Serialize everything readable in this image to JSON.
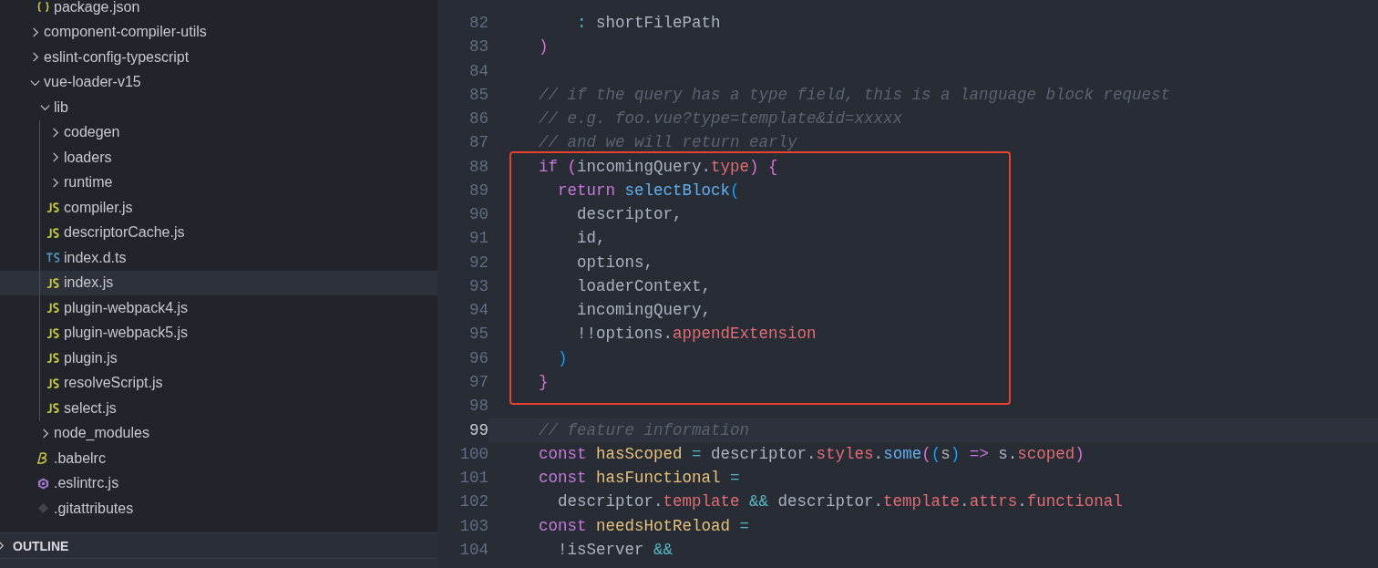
{
  "explorer": {
    "tree": [
      {
        "children": [
          {
            "name": "package.json",
            "kind": "json",
            "selected": false
          }
        ]
      },
      {
        "name": "component-compiler-utils",
        "kind": "folder",
        "expanded": false,
        "selected": false
      },
      {
        "name": "eslint-config-typescript",
        "kind": "folder",
        "expanded": false,
        "selected": false
      },
      {
        "name": "vue-loader-v15",
        "kind": "folder",
        "expanded": true,
        "selected": false,
        "children": [
          {
            "name": "lib",
            "kind": "folder",
            "expanded": true,
            "selected": false,
            "children": [
              {
                "name": "codegen",
                "kind": "folder",
                "expanded": false,
                "selected": false
              },
              {
                "name": "loaders",
                "kind": "folder",
                "expanded": false,
                "selected": false
              },
              {
                "name": "runtime",
                "kind": "folder",
                "expanded": false,
                "selected": false
              },
              {
                "name": "compiler.js",
                "kind": "js",
                "selected": false
              },
              {
                "name": "descriptorCache.js",
                "kind": "js",
                "selected": false
              },
              {
                "name": "index.d.ts",
                "kind": "ts",
                "selected": false
              },
              {
                "name": "index.js",
                "kind": "js",
                "selected": true
              },
              {
                "name": "plugin-webpack4.js",
                "kind": "js",
                "selected": false
              },
              {
                "name": "plugin-webpack5.js",
                "kind": "js",
                "selected": false
              },
              {
                "name": "plugin.js",
                "kind": "js",
                "selected": false
              },
              {
                "name": "resolveScript.js",
                "kind": "js",
                "selected": false
              },
              {
                "name": "select.js",
                "kind": "js",
                "selected": false
              }
            ]
          },
          {
            "name": "node_modules",
            "kind": "folder",
            "expanded": false,
            "selected": false
          },
          {
            "name": ".babelrc",
            "kind": "babel",
            "selected": false
          },
          {
            "name": ".eslintrc.js",
            "kind": "eslint",
            "selected": false
          },
          {
            "name": ".gitattributes",
            "kind": "git",
            "selected": false
          }
        ]
      }
    ]
  },
  "outline": {
    "title": "OUTLINE",
    "expanded": false
  },
  "editor": {
    "lines": [
      {
        "number": "82",
        "current": false,
        "boxed": false,
        "tokens": [
          {
            "kind": "op",
            "text": "    :"
          },
          {
            "kind": "plain",
            "text": " shortFilePath"
          }
        ]
      },
      {
        "number": "83",
        "current": false,
        "boxed": false,
        "tokens": [
          {
            "kind": "bracket1",
            "text": ")"
          }
        ]
      },
      {
        "number": "84",
        "current": false,
        "boxed": false
      },
      {
        "number": "85",
        "current": false,
        "boxed": false,
        "tokens": [
          {
            "kind": "comment",
            "text": "// if the query has a type field, this is a language block request"
          }
        ]
      },
      {
        "number": "86",
        "current": false,
        "boxed": false,
        "tokens": [
          {
            "kind": "comment",
            "text": "// e.g. foo.vue?type=template&id=xxxxx"
          }
        ]
      },
      {
        "number": "87",
        "current": false,
        "boxed": false,
        "tokens": [
          {
            "kind": "comment",
            "text": "// and we will return early"
          }
        ]
      },
      {
        "number": "88",
        "current": false,
        "boxed": true,
        "tokens": [
          {
            "kind": "keyword",
            "text": "if"
          },
          {
            "kind": "bracket1",
            "text": " ("
          },
          {
            "kind": "plain",
            "text": "incomingQuery."
          },
          {
            "kind": "prop",
            "text": "type"
          },
          {
            "kind": "bracket1",
            "text": ") {"
          }
        ]
      },
      {
        "number": "89",
        "current": false,
        "boxed": true,
        "tokens": [
          {
            "kind": "keyword",
            "text": "  return"
          },
          {
            "kind": "func",
            "text": " selectBlock"
          },
          {
            "kind": "bracket2",
            "text": "("
          }
        ]
      },
      {
        "number": "90",
        "current": false,
        "boxed": true,
        "tokens": [
          {
            "kind": "plain",
            "text": "    descriptor,"
          }
        ]
      },
      {
        "number": "91",
        "current": false,
        "boxed": true,
        "tokens": [
          {
            "kind": "plain",
            "text": "    id,"
          }
        ]
      },
      {
        "number": "92",
        "current": false,
        "boxed": true,
        "tokens": [
          {
            "kind": "plain",
            "text": "    options,"
          }
        ]
      },
      {
        "number": "93",
        "current": false,
        "boxed": true,
        "tokens": [
          {
            "kind": "plain",
            "text": "    loaderContext,"
          }
        ]
      },
      {
        "number": "94",
        "current": false,
        "boxed": true,
        "tokens": [
          {
            "kind": "plain",
            "text": "    incomingQuery,"
          }
        ]
      },
      {
        "number": "95",
        "current": false,
        "boxed": true,
        "tokens": [
          {
            "kind": "plain",
            "text": "    !!options."
          },
          {
            "kind": "prop",
            "text": "appendExtension"
          }
        ]
      },
      {
        "number": "96",
        "current": false,
        "boxed": true,
        "tokens": [
          {
            "kind": "bracket2",
            "text": "  )"
          }
        ]
      },
      {
        "number": "97",
        "current": false,
        "boxed": true,
        "tokens": [
          {
            "kind": "bracket1",
            "text": "}"
          }
        ]
      },
      {
        "number": "98",
        "current": false,
        "boxed": false
      },
      {
        "number": "99",
        "current": true,
        "boxed": false,
        "tokens": [
          {
            "kind": "comment",
            "text": "// feature information"
          }
        ]
      },
      {
        "number": "100",
        "current": false,
        "boxed": false,
        "tokens": [
          {
            "kind": "keyword",
            "text": "const"
          },
          {
            "kind": "var",
            "text": " hasScoped"
          },
          {
            "kind": "op",
            "text": " ="
          },
          {
            "kind": "plain",
            "text": " descriptor."
          },
          {
            "kind": "prop",
            "text": "styles"
          },
          {
            "kind": "plain",
            "text": "."
          },
          {
            "kind": "func",
            "text": "some"
          },
          {
            "kind": "bracket1",
            "text": "("
          },
          {
            "kind": "bracket2",
            "text": "("
          },
          {
            "kind": "plain",
            "text": "s"
          },
          {
            "kind": "bracket2",
            "text": ")"
          },
          {
            "kind": "keyword",
            "text": " =>"
          },
          {
            "kind": "plain",
            "text": " s."
          },
          {
            "kind": "prop",
            "text": "scoped"
          },
          {
            "kind": "bracket1",
            "text": ")"
          }
        ]
      },
      {
        "number": "101",
        "current": false,
        "boxed": false,
        "tokens": [
          {
            "kind": "keyword",
            "text": "const"
          },
          {
            "kind": "var",
            "text": " hasFunctional"
          },
          {
            "kind": "op",
            "text": " ="
          }
        ]
      },
      {
        "number": "102",
        "current": false,
        "boxed": false,
        "tokens": [
          {
            "kind": "plain",
            "text": "  descriptor."
          },
          {
            "kind": "prop",
            "text": "template"
          },
          {
            "kind": "op",
            "text": " &&"
          },
          {
            "kind": "plain",
            "text": " descriptor."
          },
          {
            "kind": "prop",
            "text": "template"
          },
          {
            "kind": "plain",
            "text": "."
          },
          {
            "kind": "prop",
            "text": "attrs"
          },
          {
            "kind": "plain",
            "text": "."
          },
          {
            "kind": "prop",
            "text": "functional"
          }
        ]
      },
      {
        "number": "103",
        "current": false,
        "boxed": false,
        "tokens": [
          {
            "kind": "keyword",
            "text": "const"
          },
          {
            "kind": "var",
            "text": " needsHotReload"
          },
          {
            "kind": "op",
            "text": " ="
          }
        ]
      },
      {
        "number": "104",
        "current": false,
        "boxed": false,
        "tokens": [
          {
            "kind": "plain",
            "text": "  !isServer "
          },
          {
            "kind": "op",
            "text": "&&"
          }
        ]
      }
    ]
  }
}
